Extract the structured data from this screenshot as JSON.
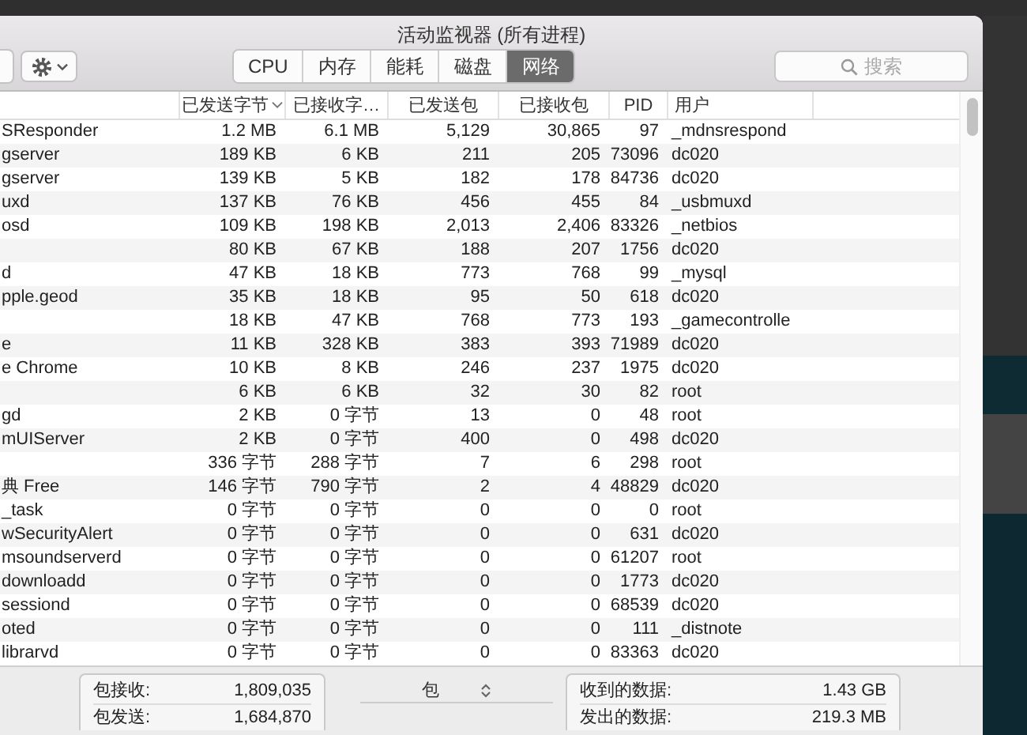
{
  "window": {
    "title": "活动监视器 (所有进程)"
  },
  "toolbar": {
    "tabs": [
      {
        "label": "CPU",
        "selected": false
      },
      {
        "label": "内存",
        "selected": false
      },
      {
        "label": "能耗",
        "selected": false
      },
      {
        "label": "磁盘",
        "selected": false
      },
      {
        "label": "网络",
        "selected": true
      }
    ],
    "search": {
      "placeholder": "搜索"
    }
  },
  "table": {
    "columns": [
      {
        "label": "已发送字节",
        "sorted": true
      },
      {
        "label": "已接收字…",
        "sorted": false
      },
      {
        "label": "已发送包",
        "sorted": false
      },
      {
        "label": "已接收包",
        "sorted": false
      },
      {
        "label": "PID",
        "sorted": false
      },
      {
        "label": "用户",
        "sorted": false
      }
    ],
    "rows": [
      {
        "name": "SResponder",
        "cells": [
          "1.2 MB",
          "6.1 MB",
          "5,129",
          "30,865",
          "97",
          "_mdnsrespond"
        ]
      },
      {
        "name": "gserver",
        "cells": [
          "189 KB",
          "6 KB",
          "211",
          "205",
          "73096",
          "dc020"
        ]
      },
      {
        "name": "gserver",
        "cells": [
          "139 KB",
          "5 KB",
          "182",
          "178",
          "84736",
          "dc020"
        ]
      },
      {
        "name": "uxd",
        "cells": [
          "137 KB",
          "76 KB",
          "456",
          "455",
          "84",
          "_usbmuxd"
        ]
      },
      {
        "name": "osd",
        "cells": [
          "109 KB",
          "198 KB",
          "2,013",
          "2,406",
          "83326",
          "_netbios"
        ]
      },
      {
        "cells": [
          "80 KB",
          "67 KB",
          "188",
          "207",
          "1756",
          "dc020"
        ]
      },
      {
        "name": "d",
        "cells": [
          "47 KB",
          "18 KB",
          "773",
          "768",
          "99",
          "_mysql"
        ]
      },
      {
        "name": "pple.geod",
        "cells": [
          "35 KB",
          "18 KB",
          "95",
          "50",
          "618",
          "dc020"
        ]
      },
      {
        "cells": [
          "18 KB",
          "47 KB",
          "768",
          "773",
          "193",
          "_gamecontrolle"
        ]
      },
      {
        "name": "e",
        "cells": [
          "11 KB",
          "328 KB",
          "383",
          "393",
          "71989",
          "dc020"
        ]
      },
      {
        "name": "e Chrome",
        "cells": [
          "10 KB",
          "8 KB",
          "246",
          "237",
          "1975",
          "dc020"
        ]
      },
      {
        "cells": [
          "6 KB",
          "6 KB",
          "32",
          "30",
          "82",
          "root"
        ]
      },
      {
        "name": "gd",
        "cells": [
          "2 KB",
          "0 字节",
          "13",
          "0",
          "48",
          "root"
        ]
      },
      {
        "name": "mUIServer",
        "cells": [
          "2 KB",
          "0 字节",
          "400",
          "0",
          "498",
          "dc020"
        ]
      },
      {
        "cells": [
          "336 字节",
          "288 字节",
          "7",
          "6",
          "298",
          "root"
        ]
      },
      {
        "name": "典 Free",
        "cells": [
          "146 字节",
          "790 字节",
          "2",
          "4",
          "48829",
          "dc020"
        ]
      },
      {
        "name": "_task",
        "cells": [
          "0 字节",
          "0 字节",
          "0",
          "0",
          "0",
          "root"
        ]
      },
      {
        "name": "wSecurityAlert",
        "cells": [
          "0 字节",
          "0 字节",
          "0",
          "0",
          "631",
          "dc020"
        ]
      },
      {
        "name": "msoundserverd",
        "cells": [
          "0 字节",
          "0 字节",
          "0",
          "0",
          "61207",
          "root"
        ]
      },
      {
        "name": "downloadd",
        "cells": [
          "0 字节",
          "0 字节",
          "0",
          "0",
          "1773",
          "dc020"
        ]
      },
      {
        "name": "sessiond",
        "cells": [
          "0 字节",
          "0 字节",
          "0",
          "0",
          "68539",
          "dc020"
        ]
      },
      {
        "name": "oted",
        "cells": [
          "0 字节",
          "0 字节",
          "0",
          "0",
          "111",
          "_distnote"
        ]
      },
      {
        "name": "librarvd",
        "cells": [
          "0 字节",
          "0 字节",
          "0",
          "0",
          "83363",
          "dc020"
        ]
      }
    ]
  },
  "footer": {
    "packets": [
      {
        "label": "包接收:",
        "value": "1,809,035"
      },
      {
        "label": "包发送:",
        "value": "1,684,870"
      }
    ],
    "unit_select": {
      "value": "包"
    },
    "data": [
      {
        "label": "收到的数据:",
        "value": "1.43 GB"
      },
      {
        "label": "发出的数据:",
        "value": "219.3 MB"
      }
    ]
  }
}
